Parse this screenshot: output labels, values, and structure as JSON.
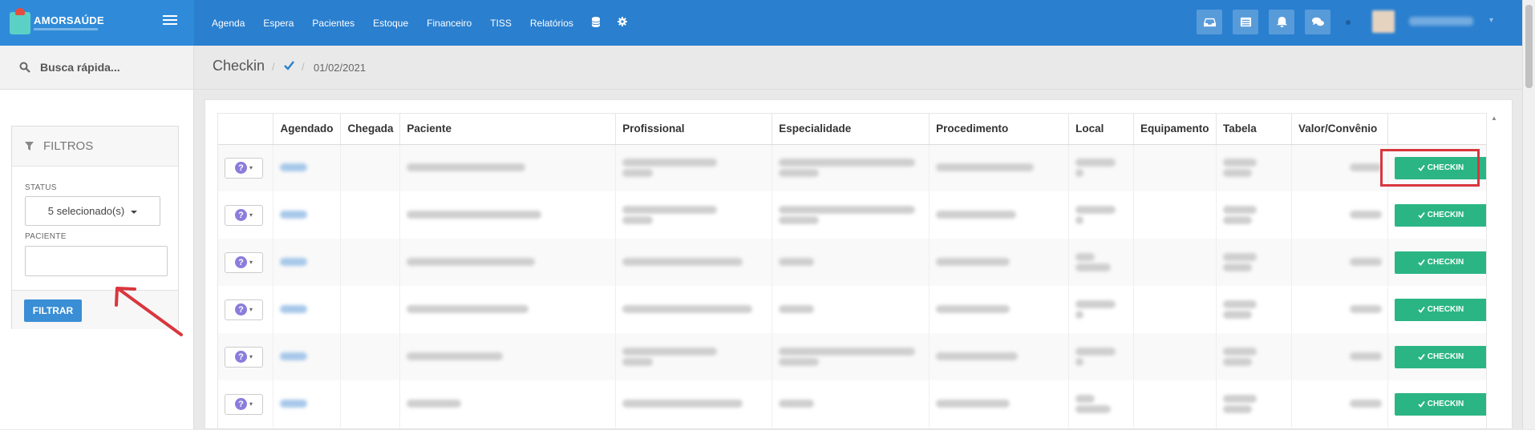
{
  "app": {
    "brand_name": "AMORSAÚDE",
    "colors": {
      "topbar": "#2a7fcf",
      "checkin_button": "#2bb585",
      "highlight": "#d9363e",
      "primary_button": "#3a8ed5"
    }
  },
  "topnav": {
    "items": [
      "Agenda",
      "Espera",
      "Pacientes",
      "Estoque",
      "Financeiro",
      "TISS",
      "Relatórios"
    ],
    "icons": [
      "database-icon",
      "gear-icon"
    ]
  },
  "toolbar": {
    "icons": [
      "inbox-icon",
      "list-icon",
      "bell-icon",
      "chat-icon"
    ]
  },
  "sidebar": {
    "search_label": "Busca rápida...",
    "filters": {
      "title": "FILTROS",
      "status_label": "STATUS",
      "status_value": "5 selecionado(s)",
      "patient_label": "PACIENTE",
      "patient_value": "",
      "submit_label": "FILTRAR"
    }
  },
  "breadcrumb": {
    "title": "Checkin",
    "date": "01/02/2021"
  },
  "table": {
    "headers": [
      "Agendado",
      "Chegada",
      "Paciente",
      "Profissional",
      "Especialidade",
      "Procedimento",
      "Local",
      "Equipamento",
      "Tabela",
      "Valor/Convênio"
    ],
    "action_label": "CHECKIN",
    "row_count": 6
  }
}
